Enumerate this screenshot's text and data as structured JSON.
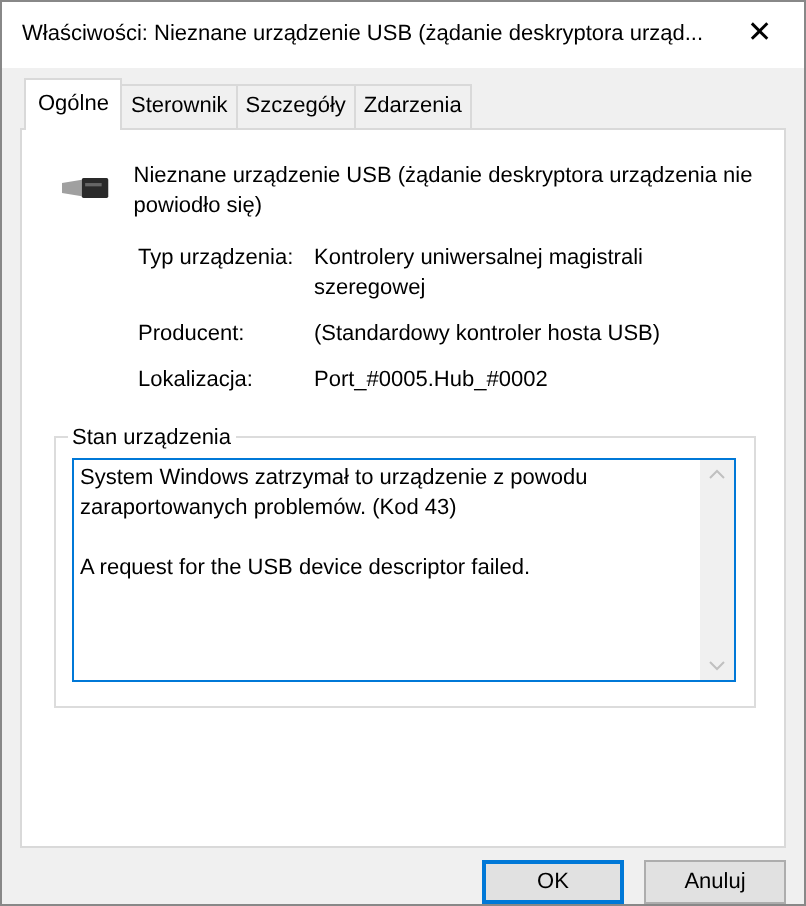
{
  "window": {
    "title": "Właściwości: Nieznane urządzenie USB (żądanie deskryptora urząd...",
    "close": "✕"
  },
  "tabs": [
    {
      "label": "Ogólne",
      "selected": true
    },
    {
      "label": "Sterownik",
      "selected": false
    },
    {
      "label": "Szczegóły",
      "selected": false
    },
    {
      "label": "Zdarzenia",
      "selected": false
    }
  ],
  "device": {
    "name": "Nieznane urządzenie USB (żądanie deskryptora urządzenia nie powiodło się)"
  },
  "properties": [
    {
      "label": "Typ urządzenia:",
      "value": "Kontrolery uniwersalnej magistrali szeregowej"
    },
    {
      "label": "Producent:",
      "value": "(Standardowy kontroler hosta USB)"
    },
    {
      "label": "Lokalizacja:",
      "value": "Port_#0005.Hub_#0002"
    }
  ],
  "status": {
    "title": "Stan urządzenia",
    "text": "System Windows zatrzymał to urządzenie z powodu zaraportowanych problemów. (Kod 43)\n\nA request for the USB device descriptor failed."
  },
  "buttons": [
    {
      "label": "OK",
      "default": true
    },
    {
      "label": "Anuluj",
      "default": false
    }
  ]
}
